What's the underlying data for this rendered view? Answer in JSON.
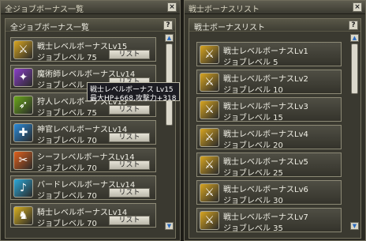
{
  "left_window": {
    "title": "全ジョブボーナス一覧",
    "header": "全ジョブボーナス一覧",
    "help": "?",
    "close": "×",
    "rows": [
      {
        "title": "戦士レベルボーナスLv15",
        "sub": "ジョブレベル 75",
        "button": "リスト",
        "icon": "warrior-icon",
        "icon_glyph": "⚔",
        "color": "#d8a520"
      },
      {
        "title": "魔術師レベルボーナスLv14",
        "sub": "ジョブレベル 70",
        "button": "リスト",
        "icon": "mage-icon",
        "icon_glyph": "✦",
        "color": "#8a3ec8"
      },
      {
        "title": "狩人レベルボーナスLv15",
        "sub": "ジョブレベル 75",
        "button": "リスト",
        "icon": "hunter-icon",
        "icon_glyph": "➶",
        "color": "#6aa81a"
      },
      {
        "title": "神官レベルボーナスLv14",
        "sub": "ジョブレベル 70",
        "button": "リスト",
        "icon": "priest-icon",
        "icon_glyph": "✚",
        "color": "#2a8ad8"
      },
      {
        "title": "シーフレベルボーナスLv14",
        "sub": "ジョブレベル 70",
        "button": "リスト",
        "icon": "thief-icon",
        "icon_glyph": "✂",
        "color": "#e0601c"
      },
      {
        "title": "バードレベルボーナスLv14",
        "sub": "ジョブレベル 70",
        "button": "リスト",
        "icon": "bard-icon",
        "icon_glyph": "♪",
        "color": "#2ca8d8"
      },
      {
        "title": "騎士レベルボーナスLv14",
        "sub": "ジョブレベル 70",
        "button": "リスト",
        "icon": "knight-icon",
        "icon_glyph": "♞",
        "color": "#d8b020"
      }
    ]
  },
  "right_window": {
    "title": "戦士ボーナスリスト",
    "header": "戦士ボーナスリスト",
    "help": "?",
    "close": "×",
    "rows": [
      {
        "title": "戦士レベルボーナスLv1",
        "sub": "ジョブレベル 5"
      },
      {
        "title": "戦士レベルボーナスLv2",
        "sub": "ジョブレベル 10"
      },
      {
        "title": "戦士レベルボーナスLv3",
        "sub": "ジョブレベル 15"
      },
      {
        "title": "戦士レベルボーナスLv4",
        "sub": "ジョブレベル 20"
      },
      {
        "title": "戦士レベルボーナスLv5",
        "sub": "ジョブレベル 25"
      },
      {
        "title": "戦士レベルボーナスLv6",
        "sub": "ジョブレベル 30"
      },
      {
        "title": "戦士レベルボーナスLv7",
        "sub": "ジョブレベル 35"
      }
    ],
    "icon": "warrior-icon",
    "icon_glyph": "⚔",
    "icon_color": "#d8a520"
  },
  "tooltip": {
    "line1": "戦士レベルボーナス Lv15",
    "line2": "最大HP+668,攻撃力+318"
  },
  "scroll": {
    "up": "▲",
    "down": "▼"
  }
}
